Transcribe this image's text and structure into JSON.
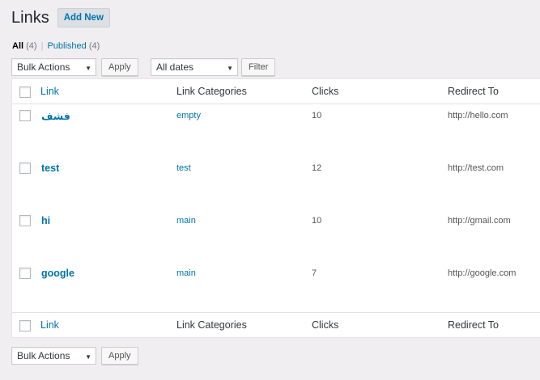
{
  "page": {
    "title": "Links",
    "add_new": "Add New"
  },
  "filters": {
    "all_label": "All",
    "all_count": "(4)",
    "separator": "|",
    "published_label": "Published",
    "published_count": "(4)"
  },
  "top_actions": {
    "bulk_actions": "Bulk Actions",
    "apply": "Apply",
    "dates": "All dates",
    "filter": "Filter"
  },
  "bottom_actions": {
    "bulk_actions": "Bulk Actions",
    "apply": "Apply"
  },
  "table": {
    "columns": [
      "Link",
      "Link Categories",
      "Clicks",
      "Redirect To"
    ],
    "rows": [
      {
        "name": "فشف",
        "category": "empty",
        "clicks": "10",
        "redirect": "http://hello.com"
      },
      {
        "name": "test",
        "category": "test",
        "clicks": "12",
        "redirect": "http://test.com"
      },
      {
        "name": "hi",
        "category": "main",
        "clicks": "10",
        "redirect": "http://gmail.com"
      },
      {
        "name": "google",
        "category": "main",
        "clicks": "7",
        "redirect": "http://google.com"
      }
    ]
  },
  "icons": {
    "dropdown": "▼"
  }
}
